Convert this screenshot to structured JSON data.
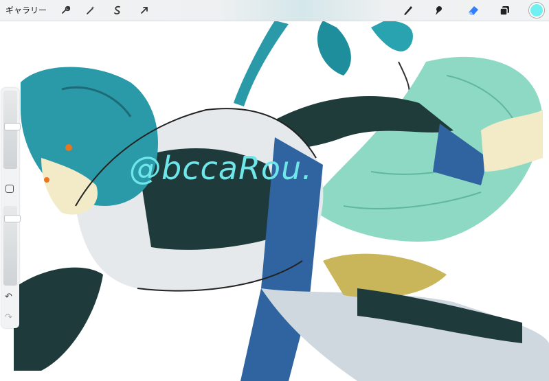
{
  "toolbar": {
    "gallery_label": "ギャラリー",
    "left_tools": [
      "wrench-icon",
      "magic-wand-icon",
      "selection-icon",
      "transform-arrow-icon"
    ],
    "right_tools": [
      "brush-icon",
      "smudge-icon",
      "eraser-icon",
      "layers-icon"
    ],
    "current_color": "#70f0f0",
    "accent_color": "#2f80ff"
  },
  "sidebar": {
    "brush_size_level": 0.55,
    "opacity_level": 0.88,
    "modify_button": "square-modify-button",
    "undo_icon": "undo-icon",
    "redo_icon": "redo-icon"
  },
  "canvas": {
    "signature_text": "@bccaRou."
  }
}
